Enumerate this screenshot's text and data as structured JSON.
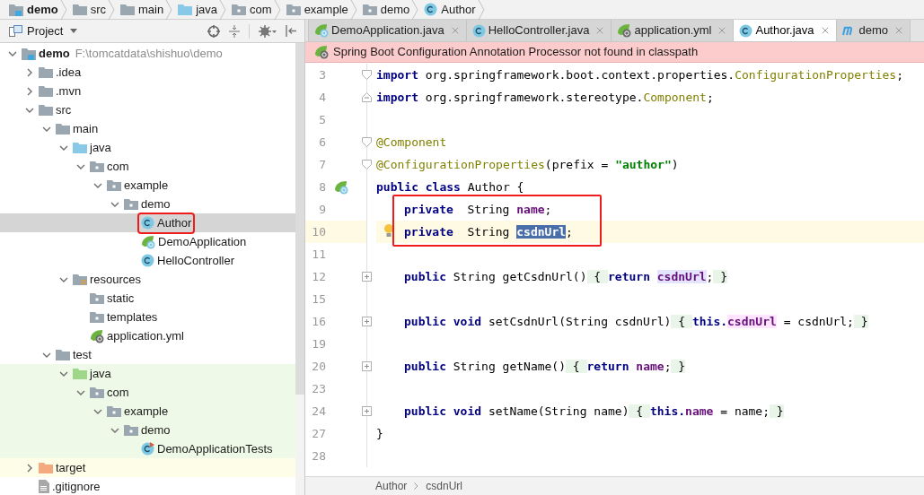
{
  "breadcrumb": [
    {
      "label": "demo",
      "kind": "module"
    },
    {
      "label": "src",
      "kind": "folder"
    },
    {
      "label": "main",
      "kind": "folder"
    },
    {
      "label": "java",
      "kind": "source"
    },
    {
      "label": "com",
      "kind": "package"
    },
    {
      "label": "example",
      "kind": "package"
    },
    {
      "label": "demo",
      "kind": "package"
    },
    {
      "label": "Author",
      "kind": "class"
    }
  ],
  "project_panel": {
    "title": "Project",
    "tree": [
      {
        "label": "demo",
        "path": "F:\\tomcatdata\\shishuo\\demo",
        "kind": "module",
        "expanded": true,
        "selected": false,
        "children": [
          {
            "label": ".idea",
            "kind": "folder",
            "expanded": false,
            "selected": false
          },
          {
            "label": ".mvn",
            "kind": "folder",
            "expanded": false,
            "selected": false
          },
          {
            "label": "src",
            "kind": "folder",
            "expanded": true,
            "selected": false,
            "children": [
              {
                "label": "main",
                "kind": "folder",
                "expanded": true,
                "selected": false,
                "children": [
                  {
                    "label": "java",
                    "kind": "source",
                    "expanded": true,
                    "selected": false,
                    "children": [
                      {
                        "label": "com",
                        "kind": "package",
                        "expanded": true,
                        "selected": false,
                        "children": [
                          {
                            "label": "example",
                            "kind": "package",
                            "expanded": true,
                            "selected": false,
                            "children": [
                              {
                                "label": "demo",
                                "kind": "package",
                                "expanded": true,
                                "selected": false,
                                "children": [
                                  {
                                    "label": "Author",
                                    "kind": "class",
                                    "selected": true,
                                    "annotated": true
                                  },
                                  {
                                    "label": "DemoApplication",
                                    "kind": "spring-class",
                                    "selected": false
                                  },
                                  {
                                    "label": "HelloController",
                                    "kind": "class",
                                    "selected": false
                                  }
                                ]
                              }
                            ]
                          }
                        ]
                      }
                    ]
                  },
                  {
                    "label": "resources",
                    "kind": "resources",
                    "expanded": true,
                    "selected": false,
                    "children": [
                      {
                        "label": "static",
                        "kind": "package",
                        "selected": false
                      },
                      {
                        "label": "templates",
                        "kind": "package",
                        "selected": false
                      },
                      {
                        "label": "application.yml",
                        "kind": "spring-file",
                        "selected": false
                      }
                    ]
                  }
                ]
              },
              {
                "label": "test",
                "kind": "folder",
                "expanded": true,
                "selected": false,
                "children": [
                  {
                    "label": "java",
                    "kind": "test-source",
                    "test_scope": true,
                    "expanded": true,
                    "selected": false,
                    "children": [
                      {
                        "label": "com",
                        "kind": "package",
                        "expanded": true,
                        "selected": false,
                        "children": [
                          {
                            "label": "example",
                            "kind": "package",
                            "expanded": true,
                            "selected": false,
                            "children": [
                              {
                                "label": "demo",
                                "kind": "package",
                                "expanded": true,
                                "selected": false,
                                "children": [
                                  {
                                    "label": "DemoApplicationTests",
                                    "kind": "test-class",
                                    "selected": false
                                  }
                                ]
                              }
                            ]
                          }
                        ]
                      }
                    ]
                  }
                ]
              }
            ]
          },
          {
            "label": "target",
            "kind": "excluded",
            "excluded": true,
            "expanded": false,
            "selected": false
          },
          {
            "label": ".gitignore",
            "kind": "text",
            "selected": false
          }
        ]
      }
    ]
  },
  "tabs": [
    {
      "label": "DemoApplication.java",
      "kind": "spring-class",
      "selected": false
    },
    {
      "label": "HelloController.java",
      "kind": "class",
      "selected": false
    },
    {
      "label": "application.yml",
      "kind": "spring-file",
      "selected": false
    },
    {
      "label": "Author.java",
      "kind": "class",
      "selected": true
    },
    {
      "label": "demo",
      "kind": "maven",
      "selected": false
    }
  ],
  "banner": "Spring Boot Configuration Annotation Processor not found in classpath",
  "editor": {
    "lines": [
      {
        "number": "3",
        "fold": {
          "kind": "start"
        },
        "tokens": [
          {
            "text": "import",
            "kind": "keyword"
          },
          {
            "text": " org.springframework.boot.context.properties.",
            "kind": "plain"
          },
          {
            "text": "ConfigurationProperties",
            "kind": "annotation"
          },
          {
            "text": ";",
            "kind": "plain"
          }
        ]
      },
      {
        "number": "4",
        "fold": {
          "kind": "end"
        },
        "tokens": [
          {
            "text": "import",
            "kind": "keyword"
          },
          {
            "text": " org.springframework.stereotype.",
            "kind": "plain"
          },
          {
            "text": "Component",
            "kind": "annotation"
          },
          {
            "text": ";",
            "kind": "plain"
          }
        ]
      },
      {
        "number": "5"
      },
      {
        "number": "6",
        "fold": {
          "kind": "start"
        },
        "tokens": [
          {
            "text": "@Component",
            "kind": "annotation"
          }
        ]
      },
      {
        "number": "7",
        "fold": {
          "kind": "start"
        },
        "tokens": [
          {
            "text": "@ConfigurationProperties",
            "kind": "annotation"
          },
          {
            "text": "(prefix = ",
            "kind": "plain"
          },
          {
            "text": "\"author\"",
            "kind": "string"
          },
          {
            "text": ")",
            "kind": "plain"
          }
        ]
      },
      {
        "number": "8",
        "gutter_icon": {
          "kind": "bean"
        },
        "tokens": [
          {
            "text": "public class",
            "kind": "keyword"
          },
          {
            "text": " Author {",
            "kind": "plain"
          }
        ]
      },
      {
        "number": "9",
        "indent": true,
        "boxed": true,
        "tokens": [
          {
            "text": "private",
            "kind": "keyword"
          },
          {
            "text": "  String ",
            "kind": "plain"
          },
          {
            "text": "name",
            "kind": "field"
          },
          {
            "text": ";",
            "kind": "plain"
          }
        ]
      },
      {
        "number": "10",
        "indent": true,
        "boxed": true,
        "current": true,
        "bulb": true,
        "tokens": [
          {
            "text": "private",
            "kind": "keyword"
          },
          {
            "text": "  String ",
            "kind": "plain"
          },
          {
            "text": "csdnUrl",
            "kind": "field",
            "selected": true
          },
          {
            "text": ";",
            "kind": "plain"
          }
        ]
      },
      {
        "number": "11"
      },
      {
        "number": "12",
        "indent": true,
        "fold": {
          "kind": "collapsed"
        },
        "tokens": [
          {
            "text": "public",
            "kind": "keyword"
          },
          {
            "text": " String getCsdnUrl()",
            "kind": "plain"
          },
          {
            "text": " { ",
            "kind": "plain",
            "folded": true
          },
          {
            "text": "return ",
            "kind": "keyword"
          },
          {
            "text": "csdnUrl",
            "kind": "field",
            "read_usage": true
          },
          {
            "text": ";",
            "kind": "plain"
          },
          {
            "text": " }",
            "kind": "plain",
            "folded": true
          }
        ]
      },
      {
        "number": "15"
      },
      {
        "number": "16",
        "indent": true,
        "fold": {
          "kind": "collapsed"
        },
        "tokens": [
          {
            "text": "public void",
            "kind": "keyword"
          },
          {
            "text": " setCsdnUrl(String csdnUrl)",
            "kind": "plain"
          },
          {
            "text": " { ",
            "kind": "plain",
            "folded": true
          },
          {
            "text": "this.",
            "kind": "keyword"
          },
          {
            "text": "csdnUrl",
            "kind": "field",
            "write_usage": true
          },
          {
            "text": " = csdnUrl;",
            "kind": "plain"
          },
          {
            "text": " }",
            "kind": "plain",
            "folded": true
          }
        ]
      },
      {
        "number": "19"
      },
      {
        "number": "20",
        "indent": true,
        "fold": {
          "kind": "collapsed"
        },
        "tokens": [
          {
            "text": "public",
            "kind": "keyword"
          },
          {
            "text": " String getName()",
            "kind": "plain"
          },
          {
            "text": " { ",
            "kind": "plain",
            "folded": true
          },
          {
            "text": "return ",
            "kind": "keyword"
          },
          {
            "text": "name",
            "kind": "field"
          },
          {
            "text": ";",
            "kind": "plain"
          },
          {
            "text": " }",
            "kind": "plain",
            "folded": true
          }
        ]
      },
      {
        "number": "23"
      },
      {
        "number": "24",
        "indent": true,
        "fold": {
          "kind": "collapsed"
        },
        "tokens": [
          {
            "text": "public void",
            "kind": "keyword"
          },
          {
            "text": " setName(String name)",
            "kind": "plain"
          },
          {
            "text": " { ",
            "kind": "plain",
            "folded": true
          },
          {
            "text": "this.",
            "kind": "keyword"
          },
          {
            "text": "name",
            "kind": "field"
          },
          {
            "text": " = name;",
            "kind": "plain"
          },
          {
            "text": " }",
            "kind": "plain",
            "folded": true
          }
        ]
      },
      {
        "number": "27",
        "tokens": [
          {
            "text": "}",
            "kind": "plain"
          }
        ]
      },
      {
        "number": "28"
      }
    ]
  },
  "editor_breadcrumb": [
    "Author",
    "csdnUrl"
  ]
}
